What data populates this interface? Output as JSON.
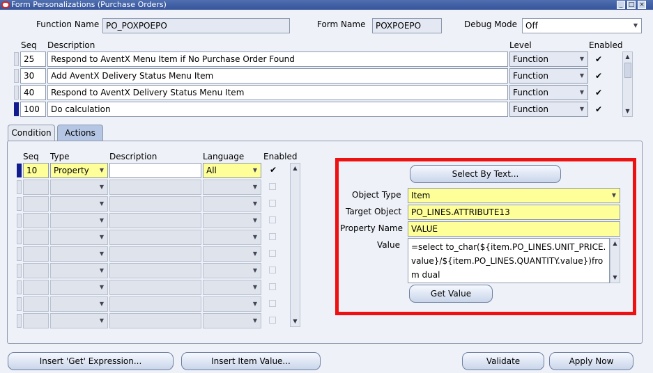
{
  "window": {
    "title": "Form Personalizations (Purchase Orders)"
  },
  "header": {
    "function_name_label": "Function Name",
    "function_name_value": "PO_POXPOEPO",
    "form_name_label": "Form Name",
    "form_name_value": "POXPOEPO",
    "debug_mode_label": "Debug Mode",
    "debug_mode_value": "Off"
  },
  "rules": {
    "col_seq": "Seq",
    "col_description": "Description",
    "col_level": "Level",
    "col_enabled": "Enabled",
    "rows": [
      {
        "seq": "25",
        "description": "Respond to AventX Menu Item if No Purchase Order Found",
        "level": "Function",
        "enabled": "✔"
      },
      {
        "seq": "30",
        "description": "Add AventX Delivery Status Menu Item",
        "level": "Function",
        "enabled": "✔"
      },
      {
        "seq": "40",
        "description": "Respond to AventX Delivery Status Menu Item",
        "level": "Function",
        "enabled": "✔"
      },
      {
        "seq": "100",
        "description": "Do calculation",
        "level": "Function",
        "enabled": "✔"
      }
    ]
  },
  "tabs": {
    "condition": "Condition",
    "actions": "Actions"
  },
  "actions": {
    "col_seq": "Seq",
    "col_type": "Type",
    "col_description": "Description",
    "col_language": "Language",
    "col_enabled": "Enabled",
    "first_row": {
      "seq": "10",
      "type": "Property",
      "description": "",
      "language": "All",
      "enabled": "✔"
    }
  },
  "property": {
    "select_by_text": "Select By Text...",
    "object_type_label": "Object Type",
    "object_type_value": "Item",
    "target_object_label": "Target Object",
    "target_object_value": "PO_LINES.ATTRIBUTE13",
    "property_name_label": "Property Name",
    "property_name_value": "VALUE",
    "value_label": "Value",
    "value_text": "=select to_char(${item.PO_LINES.UNIT_PRICE.value}/${item.PO_LINES.QUANTITY.value})from dual",
    "get_value": "Get Value"
  },
  "footer": {
    "insert_get": "Insert 'Get' Expression...",
    "insert_item": "Insert Item Value...",
    "validate": "Validate",
    "apply_now": "Apply Now"
  },
  "colors": {
    "highlight_box": "#ee1111",
    "required_field": "#ffff99",
    "current_record": "#111c8f"
  }
}
